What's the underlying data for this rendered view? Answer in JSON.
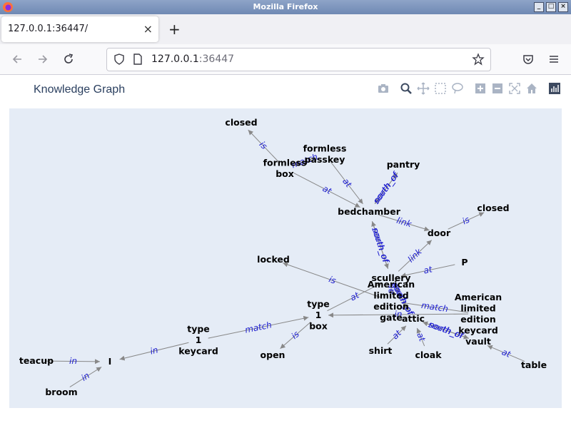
{
  "window": {
    "title": "Mozilla Firefox"
  },
  "tab": {
    "title": "127.0.0.1:36447/",
    "close": "×",
    "new_tab": "+"
  },
  "url": {
    "host": "127.0.0.1",
    "port": ":36447"
  },
  "plot": {
    "title": "Knowledge Graph"
  },
  "colors": {
    "plot_bg": "#e5ecf6",
    "edge": "#888888",
    "edge_label": "#1f1fcf",
    "title": "#2a3f5f"
  },
  "graph": {
    "nodes": [
      {
        "id": "closed1",
        "label": "closed"
      },
      {
        "id": "formless_passkey",
        "label": "formless\npasskey"
      },
      {
        "id": "formless_box",
        "label": "formless\nbox"
      },
      {
        "id": "pantry",
        "label": "pantry"
      },
      {
        "id": "bedchamber",
        "label": "bedchamber"
      },
      {
        "id": "closed2",
        "label": "closed"
      },
      {
        "id": "door",
        "label": "door"
      },
      {
        "id": "P",
        "label": "P"
      },
      {
        "id": "locked",
        "label": "locked"
      },
      {
        "id": "scullery",
        "label": "scullery"
      },
      {
        "id": "amer_gate",
        "label": "American\nlimited\nedition\ngate"
      },
      {
        "id": "amer_keycard",
        "label": "American\nlimited\nedition\nkeycard"
      },
      {
        "id": "type1box",
        "label": "type\n1\nbox"
      },
      {
        "id": "attic",
        "label": "attic"
      },
      {
        "id": "type1keycard",
        "label": "type\n1\nkeycard"
      },
      {
        "id": "vault",
        "label": "vault"
      },
      {
        "id": "shirt",
        "label": "shirt"
      },
      {
        "id": "cloak",
        "label": "cloak"
      },
      {
        "id": "open",
        "label": "open"
      },
      {
        "id": "teacup",
        "label": "teacup"
      },
      {
        "id": "I",
        "label": "I"
      },
      {
        "id": "table",
        "label": "table"
      },
      {
        "id": "broom",
        "label": "broom"
      }
    ],
    "edges": [
      {
        "from": "formless_box",
        "to": "closed1",
        "label": "is"
      },
      {
        "from": "formless_passkey",
        "to": "formless_box",
        "label": "match"
      },
      {
        "from": "formless_passkey",
        "to": "bedchamber",
        "label": "at"
      },
      {
        "from": "formless_box",
        "to": "bedchamber",
        "label": "at"
      },
      {
        "from": "bedchamber",
        "to": "pantry",
        "label": "north_of"
      },
      {
        "from": "pantry",
        "to": "bedchamber",
        "label": "south_of"
      },
      {
        "from": "bedchamber",
        "to": "door",
        "label": "link"
      },
      {
        "from": "door",
        "to": "closed2",
        "label": "is"
      },
      {
        "from": "bedchamber",
        "to": "scullery",
        "label": "south_of"
      },
      {
        "from": "scullery",
        "to": "bedchamber",
        "label": "north_of"
      },
      {
        "from": "scullery",
        "to": "door",
        "label": "link"
      },
      {
        "from": "P",
        "to": "scullery",
        "label": "at"
      },
      {
        "from": "amer_gate",
        "to": "locked",
        "label": "is"
      },
      {
        "from": "amer_keycard",
        "to": "amer_gate",
        "label": "match"
      },
      {
        "from": "amer_gate",
        "to": "scullery",
        "label": "at"
      },
      {
        "from": "type1box",
        "to": "scullery",
        "label": "at"
      },
      {
        "from": "attic",
        "to": "scullery",
        "label": "north_of"
      },
      {
        "from": "scullery",
        "to": "attic",
        "label": "south_of"
      },
      {
        "from": "amer_keycard",
        "to": "type1box",
        "label": "in"
      },
      {
        "from": "type1keycard",
        "to": "type1box",
        "label": "match"
      },
      {
        "from": "type1box",
        "to": "open",
        "label": "is"
      },
      {
        "from": "type1keycard",
        "to": "I",
        "label": "in"
      },
      {
        "from": "shirt",
        "to": "attic",
        "label": "at"
      },
      {
        "from": "cloak",
        "to": "attic",
        "label": "at"
      },
      {
        "from": "vault",
        "to": "attic",
        "label": "north_of"
      },
      {
        "from": "attic",
        "to": "vault",
        "label": "south_of"
      },
      {
        "from": "table",
        "to": "vault",
        "label": "at"
      },
      {
        "from": "teacup",
        "to": "I",
        "label": "in"
      },
      {
        "from": "broom",
        "to": "I",
        "label": "in"
      }
    ]
  }
}
